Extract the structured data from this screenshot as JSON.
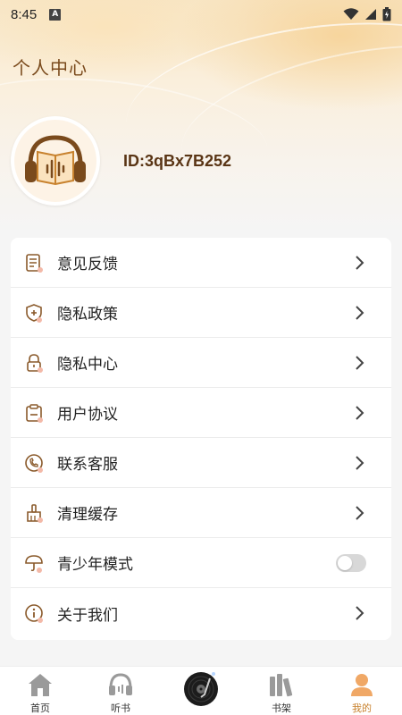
{
  "status_bar": {
    "time": "8:45",
    "notification_badge": "A"
  },
  "page": {
    "title": "个人中心"
  },
  "profile": {
    "user_id": "ID:3qBx7B252"
  },
  "menu": {
    "items": [
      {
        "label": "意见反馈",
        "icon": "feedback-icon",
        "control": "chevron"
      },
      {
        "label": "隐私政策",
        "icon": "shield-plus-icon",
        "control": "chevron"
      },
      {
        "label": "隐私中心",
        "icon": "lock-icon",
        "control": "chevron"
      },
      {
        "label": "用户协议",
        "icon": "clipboard-icon",
        "control": "chevron"
      },
      {
        "label": "联系客服",
        "icon": "phone-icon",
        "control": "chevron"
      },
      {
        "label": "清理缓存",
        "icon": "broom-icon",
        "control": "chevron"
      },
      {
        "label": "青少年模式",
        "icon": "umbrella-icon",
        "control": "toggle",
        "toggle_on": false
      },
      {
        "label": "关于我们",
        "icon": "info-icon",
        "control": "chevron"
      }
    ]
  },
  "bottom_nav": {
    "items": [
      {
        "label": "首页",
        "icon": "home-icon"
      },
      {
        "label": "听书",
        "icon": "headphones-icon"
      },
      {
        "label": "",
        "icon": "vinyl-disc-icon"
      },
      {
        "label": "书架",
        "icon": "bookshelf-icon"
      },
      {
        "label": "我的",
        "icon": "person-icon",
        "active": true
      }
    ]
  },
  "colors": {
    "accent": "#c8822e",
    "title_brown": "#7a4a1c",
    "icon_brown": "#8a5a2b"
  }
}
